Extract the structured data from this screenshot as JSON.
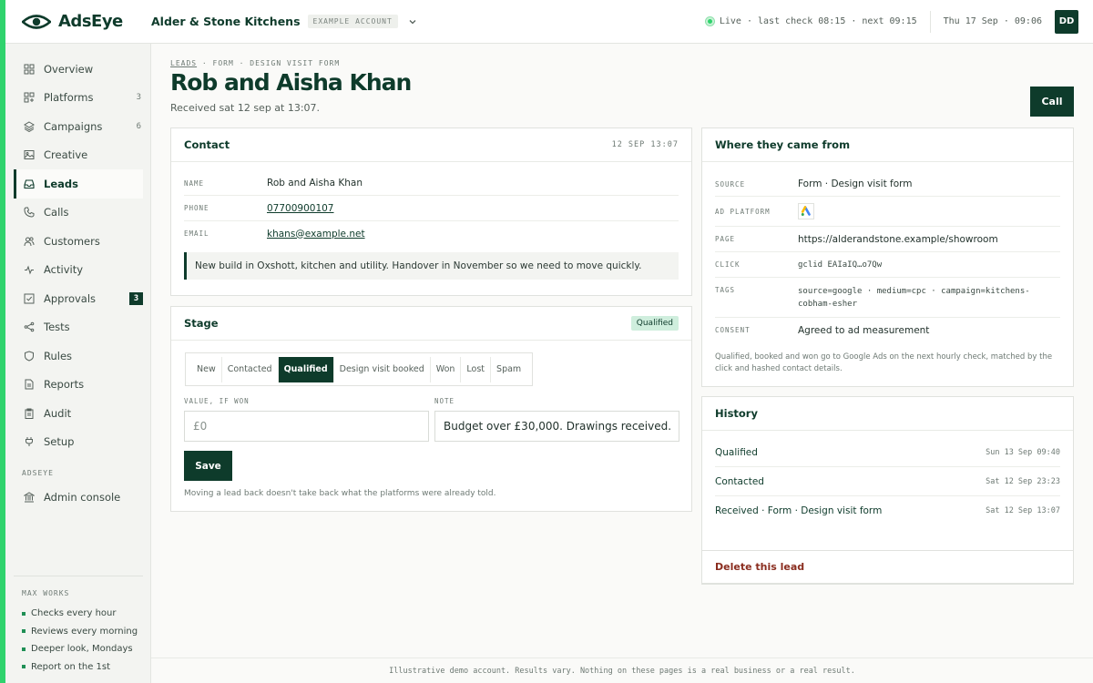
{
  "app": {
    "name": "AdsEye",
    "logo_icon": "eye-logo-icon",
    "accent": "#2fd36d",
    "brand": "#0e3b2b"
  },
  "account": {
    "name": "Alder & Stone Kitchens",
    "badge": "EXAMPLE ACCOUNT"
  },
  "status": {
    "text": "Live · last check 08:15 · next 09:15",
    "datetime": "Thu 17 Sep · 09:06"
  },
  "user": {
    "initials": "DD"
  },
  "sidebar": {
    "items": [
      {
        "label": "Overview",
        "icon": "grid-icon",
        "count": ""
      },
      {
        "label": "Platforms",
        "icon": "platforms-icon",
        "count": "3"
      },
      {
        "label": "Campaigns",
        "icon": "layers-icon",
        "count": "6"
      },
      {
        "label": "Creative",
        "icon": "image-icon",
        "count": ""
      },
      {
        "label": "Leads",
        "icon": "inbox-icon",
        "count": ""
      },
      {
        "label": "Calls",
        "icon": "phone-icon",
        "count": ""
      },
      {
        "label": "Customers",
        "icon": "users-icon",
        "count": ""
      },
      {
        "label": "Activity",
        "icon": "activity-icon",
        "count": ""
      },
      {
        "label": "Approvals",
        "icon": "check-square-icon",
        "count": "3"
      },
      {
        "label": "Tests",
        "icon": "share-icon",
        "count": ""
      },
      {
        "label": "Rules",
        "icon": "shield-icon",
        "count": ""
      },
      {
        "label": "Reports",
        "icon": "file-icon",
        "count": ""
      },
      {
        "label": "Audit",
        "icon": "clipboard-icon",
        "count": ""
      },
      {
        "label": "Setup",
        "icon": "plug-icon",
        "count": ""
      }
    ],
    "section_label": "ADSEYE",
    "admin": {
      "label": "Admin console",
      "icon": "bank-icon"
    },
    "max_works": {
      "title": "MAX WORKS",
      "items": [
        "Checks every hour",
        "Reviews every morning",
        "Deeper look, Mondays",
        "Report on the 1st"
      ]
    }
  },
  "breadcrumb": {
    "root": "LEADS",
    "rest": " · FORM · DESIGN VISIT FORM"
  },
  "page": {
    "title": "Rob and Aisha Khan",
    "subtitle": "Received sat 12 sep at 13:07.",
    "call_label": "Call"
  },
  "contact": {
    "title": "Contact",
    "timestamp": "12 SEP 13:07",
    "fields": [
      {
        "label": "NAME",
        "value": "Rob and Aisha Khan"
      },
      {
        "label": "PHONE",
        "value": "07700900107"
      },
      {
        "label": "EMAIL",
        "value": "khans@example.net"
      }
    ],
    "note": "New build in Oxshott, kitchen and utility. Handover in November so we need to move quickly."
  },
  "stage": {
    "title": "Stage",
    "badge": "Qualified",
    "options": [
      "New",
      "Contacted",
      "Qualified",
      "Design visit booked",
      "Won",
      "Lost",
      "Spam"
    ],
    "selected": "Qualified",
    "value_label": "VALUE, IF WON",
    "value_placeholder": "£0",
    "note_label": "NOTE",
    "note_value": "Budget over £30,000. Drawings received.",
    "save_label": "Save",
    "footnote": "Moving a lead back doesn't take back what the platforms were already told."
  },
  "origin": {
    "title": "Where they came from",
    "source_label": "SOURCE",
    "source_value": "Form · Design visit form",
    "platform_label": "AD PLATFORM",
    "platform_icon": "google-ads-icon",
    "page_label": "PAGE",
    "page_value": "https://alderandstone.example/showroom",
    "click_label": "CLICK",
    "click_value": "gclid EAIaIQ…o7Qw",
    "tags_label": "TAGS",
    "tags_line1": "source=google · medium=cpc · campaign=kitchens-",
    "tags_line2": "cobham-esher",
    "consent_label": "CONSENT",
    "consent_value": "Agreed to ad measurement",
    "footnote_line1": "Qualified, booked and won go to Google Ads on the next hourly check, matched by the",
    "footnote_line2": "click and hashed contact details."
  },
  "history": {
    "title": "History",
    "events": [
      {
        "label": "Qualified",
        "time": "Sun 13 Sep 09:40"
      },
      {
        "label": "Contacted",
        "time": "Sat 12 Sep 23:23"
      },
      {
        "label": "Received · Form · Design visit form",
        "time": "Sat 12 Sep 13:07"
      }
    ]
  },
  "danger": {
    "delete_label": "Delete this lead"
  },
  "footer": {
    "text": "Illustrative demo account. Results vary. Nothing on these pages is a real business or a real result."
  }
}
